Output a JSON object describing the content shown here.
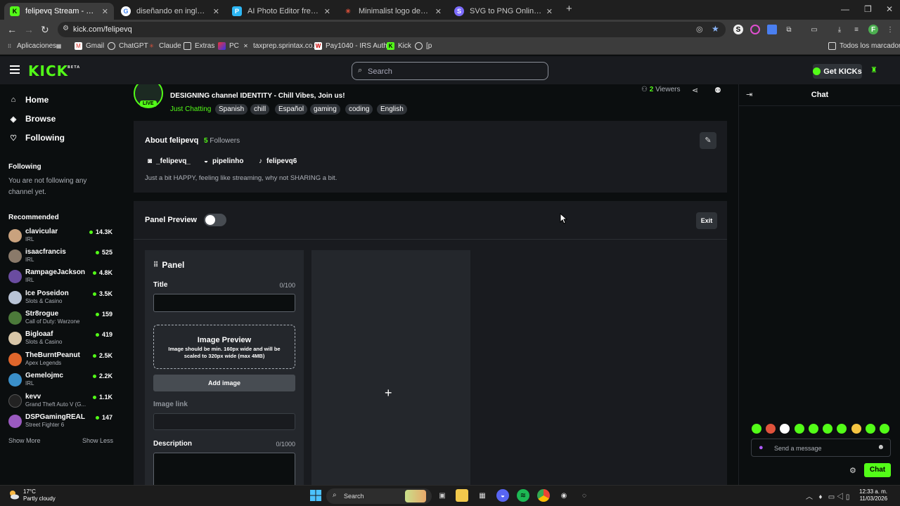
{
  "browser": {
    "tabs": [
      {
        "title": "felipevq Stream - Watch Live on",
        "active": true,
        "favicon_color": "#53fc18",
        "favicon_char": "K"
      },
      {
        "title": "diseñando en ingles - Buscar co",
        "active": false,
        "favicon_color": "#ffffff",
        "favicon_char": "G"
      },
      {
        "title": "AI Photo Editor free : Pixlr Expre",
        "active": false,
        "favicon_color": "#2db7f5",
        "favicon_char": "P"
      },
      {
        "title": "Minimalist logo design for felip",
        "active": false,
        "favicon_color": "#e0533c",
        "favicon_char": "✳"
      },
      {
        "title": "SVG to PNG Online Converter f",
        "active": false,
        "favicon_color": "#7c6cff",
        "favicon_char": "S"
      }
    ],
    "url": "kick.com/felipevq",
    "bookmarks": [
      {
        "label": "Aplicaciones"
      },
      {
        "label": "Gmail"
      },
      {
        "label": "ChatGPT"
      },
      {
        "label": "Claude"
      },
      {
        "label": "Extras"
      },
      {
        "label": "PC"
      },
      {
        "label": "taxprep.sprintax.co..."
      },
      {
        "label": "Pay1040 - IRS Auth..."
      },
      {
        "label": "Kick"
      },
      {
        "label": "[p"
      }
    ],
    "all_bookmarks": "Todos los marcadores"
  },
  "header": {
    "logo": "KICK",
    "beta": "BETA",
    "search_placeholder": "Search",
    "get_kicks": "Get KICKs"
  },
  "sidebar": {
    "nav": [
      {
        "label": "Home",
        "icon": "home-icon"
      },
      {
        "label": "Browse",
        "icon": "compass-icon"
      },
      {
        "label": "Following",
        "icon": "heart-icon"
      }
    ],
    "following_heading": "Following",
    "following_empty": "You are not following any channel yet.",
    "recommended_heading": "Recommended",
    "recommended": [
      {
        "name": "clavicular",
        "category": "IRL",
        "viewers": "14.3K",
        "color": "#c9a27e"
      },
      {
        "name": "isaacfrancis",
        "category": "IRL",
        "viewers": "525",
        "color": "#8a7a6a"
      },
      {
        "name": "RampageJackson",
        "category": "IRL",
        "viewers": "4.8K",
        "color": "#6a4ca0"
      },
      {
        "name": "Ice Poseidon",
        "category": "Slots & Casino",
        "viewers": "3.5K",
        "color": "#b9c4d6"
      },
      {
        "name": "Str8rogue",
        "category": "Call of Duty: Warzone",
        "viewers": "159",
        "color": "#4c7a3a"
      },
      {
        "name": "Bigloaaf",
        "category": "Slots & Casino",
        "viewers": "419",
        "color": "#d8c6a8"
      },
      {
        "name": "TheBurntPeanut",
        "category": "Apex Legends",
        "viewers": "2.5K",
        "color": "#e0662b"
      },
      {
        "name": "Gemelojmc",
        "category": "IRL",
        "viewers": "2.2K",
        "color": "#3a8fc9"
      },
      {
        "name": "kevv",
        "category": "Grand Theft Auto V (G...",
        "viewers": "1.1K",
        "color": "#222222"
      },
      {
        "name": "DSPGamingREAL",
        "category": "Street Fighter 6",
        "viewers": "147",
        "color": "#9a5ac0"
      }
    ],
    "show_more": "Show More",
    "show_less": "Show Less"
  },
  "channel": {
    "name": "felipevq",
    "live": "LIVE",
    "stream_title": "DESIGNING channel IDENTITY - Chill Vibes, Join us!",
    "category": "Just Chatting",
    "tags": [
      "Spanish",
      "chill",
      "Español",
      "gaming",
      "coding",
      "English"
    ],
    "viewers_count": "2",
    "viewers_label": "Viewers"
  },
  "about": {
    "title": "About felipevq",
    "followers_count": "5",
    "followers_label": "Followers",
    "socials": [
      {
        "label": "_felipevq_",
        "icon": "instagram-icon"
      },
      {
        "label": "pipelinho",
        "icon": "discord-icon"
      },
      {
        "label": "felipevq6",
        "icon": "tiktok-icon"
      }
    ],
    "bio": "Just a bit HAPPY, feeling like streaming, why not SHARING a bit."
  },
  "panel_preview": {
    "label": "Panel Preview",
    "toggle_on": false,
    "exit": "Exit"
  },
  "panel_editor": {
    "heading": "Panel",
    "title_label": "Title",
    "title_count": "0/100",
    "title_value": "",
    "image_preview_title": "Image Preview",
    "image_preview_note": "Image should be min. 160px wide and will be scaled to 320px wide (max 4MB)",
    "add_image": "Add image",
    "image_link_label": "Image link",
    "image_link_value": "",
    "description_label": "Description",
    "description_count": "0/1000",
    "description_value": ""
  },
  "chat": {
    "title": "Chat",
    "message_placeholder": "Send a message",
    "send": "Chat",
    "emote_colors": [
      "#53fc18",
      "#e0533c",
      "#ffffff",
      "#53fc18",
      "#53fc18",
      "#53fc18",
      "#53fc18",
      "#f5c542",
      "#53fc18",
      "#53fc18"
    ]
  },
  "taskbar": {
    "temperature": "17°C",
    "weather": "Partly cloudy",
    "search": "Search",
    "time": "12:33 a. m.",
    "date": "11/03/2026"
  }
}
